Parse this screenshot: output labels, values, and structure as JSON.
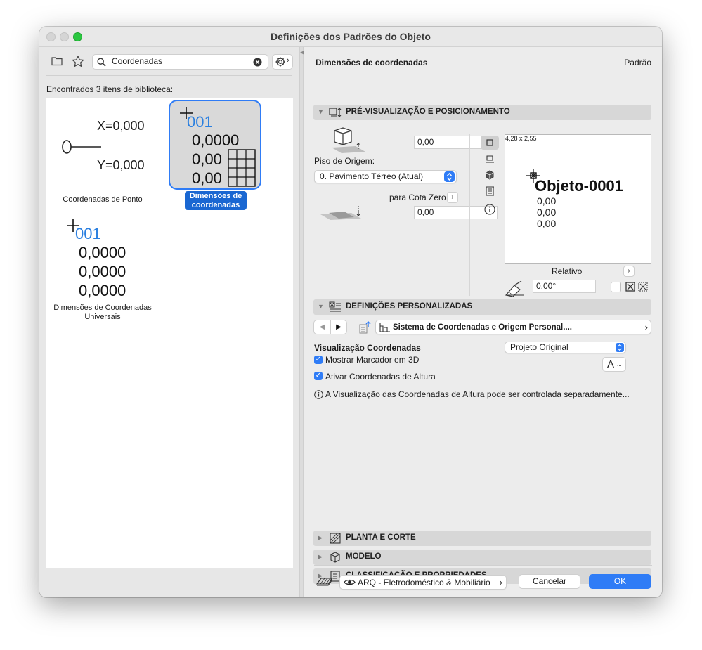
{
  "window": {
    "title": "Definições dos Padrões do Objeto"
  },
  "left": {
    "search_value": "Coordenadas",
    "found_text": "Encontrados 3 itens de biblioteca:",
    "items": [
      {
        "label": "Coordenadas de Ponto",
        "x_text": "X=0,000",
        "y_text": "Y=0,000"
      },
      {
        "label": "Dimensões de coordenadas",
        "label_line1": "Dimensões de",
        "label_line2": "coordenadas",
        "num": "001",
        "v1": "0,0000",
        "v2": "0,00",
        "v3": "0,00"
      },
      {
        "label": "Dimensões de Coordenadas Universais",
        "label_line1": "Dimensões de Coordenadas",
        "label_line2": "Universais",
        "num": "001",
        "v1": "0,0000",
        "v2": "0,0000",
        "v3": "0,0000"
      }
    ]
  },
  "right": {
    "header_title": "Dimensões de coordenadas",
    "header_right": "Padrão",
    "section1": {
      "title": "PRÉ-VISUALIZAÇÃO E POSICIONAMENTO",
      "elevation_value": "0,00",
      "floor_label": "Piso de Origem:",
      "floor_value": "0. Pavimento Térreo (Atual)",
      "zero_label": "para Cota Zero",
      "zero_value": "0,00",
      "preview_size": "4,28 x 2,55",
      "preview_object": "Objeto-0001",
      "preview_values": [
        "0,00",
        "0,00",
        "0,00"
      ],
      "relative_label": "Relativo",
      "angle_value": "0,00°"
    },
    "section2": {
      "title": "DEFINIÇÕES PERSONALIZADAS",
      "nav_title": "Sistema de Coordenadas e Origem Personal....",
      "viz_label": "Visualização Coordenadas",
      "viz_value": "Projeto Original",
      "font_btn": "A",
      "font_btn_dots": "...",
      "cb1_label": "Mostrar Marcador em 3D",
      "cb1_checked": true,
      "cb2_label": "Ativar Coordenadas de Altura",
      "cb2_checked": true,
      "info_text": "A Visualização das Coordenadas de Altura pode ser controlada separadamente..."
    },
    "collapsed_sections": [
      {
        "title": "PLANTA E CORTE"
      },
      {
        "title": "MODELO"
      },
      {
        "title": "CLASSIFICAÇÃO E PROPRIEDADES"
      }
    ],
    "footer": {
      "layer_value": "ARQ - Eletrodoméstico & Mobiliário",
      "cancel": "Cancelar",
      "ok": "OK"
    }
  },
  "colors": {
    "accent": "#2f7cf6",
    "selection": "#1a67d2",
    "green_light": "#2ac740"
  }
}
